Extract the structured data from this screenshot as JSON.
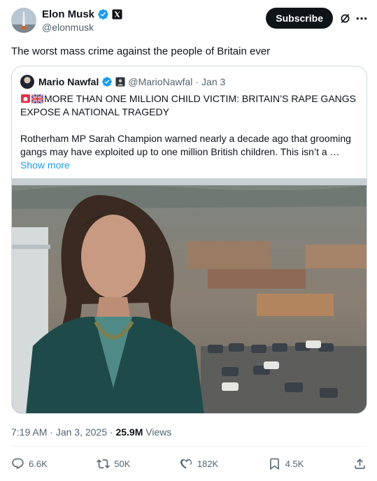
{
  "author": {
    "display_name": "Elon Musk",
    "handle": "@elonmusk",
    "subscribe_label": "Subscribe"
  },
  "tweet": {
    "text": "The worst mass crime against the people of Britain ever",
    "time": "7:19 AM",
    "date": "Jan 3, 2025",
    "views_count": "25.9M",
    "views_label": "Views"
  },
  "quote": {
    "display_name": "Mario Nawfal",
    "handle": "@MarioNawfal",
    "date": "Jan 3",
    "headline": "MORE THAN ONE MILLION CHILD VICTIM: BRITAIN’S RAPE GANGS EXPOSE A NATIONAL TRAGEDY",
    "headline_emoji": [
      "siren",
      "uk-flag"
    ],
    "body": "Rotherham MP Sarah Champion warned nearly a decade ago that grooming gangs may have exploited up to one million British children. This isn’t a …",
    "show_more": "Show more"
  },
  "actions": {
    "replies": "6.6K",
    "reposts": "50K",
    "likes": "182K",
    "bookmarks": "4.5K"
  },
  "icons": [
    "verified-badge-icon",
    "x-affiliation-icon",
    "grok-icon",
    "more-icon",
    "reply-icon",
    "repost-icon",
    "like-icon",
    "bookmark-icon",
    "share-icon"
  ],
  "colors": {
    "verified": "#1d9bf0",
    "link": "#1d9bf0",
    "secondary_text": "#536471",
    "border": "#cfd9de"
  }
}
